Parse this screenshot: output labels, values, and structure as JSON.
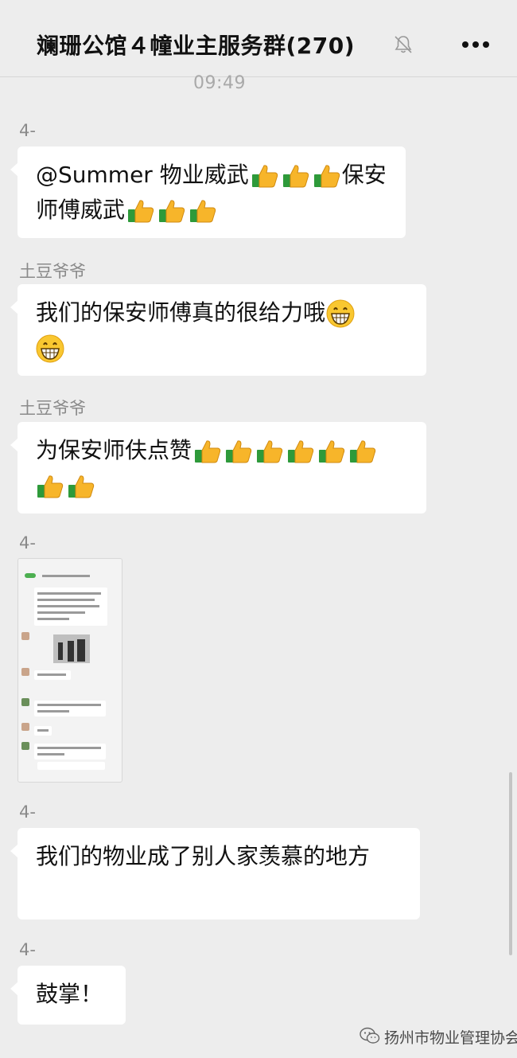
{
  "header": {
    "title": "斓珊公馆４幢业主服务群(270)",
    "mute_icon": "bell-mute-icon",
    "more_icon": "ellipsis-icon"
  },
  "timestamp": "09:49",
  "messages": [
    {
      "sender": "4-",
      "text_1": "@Summer 物业威武",
      "text_2": "保安师傅威武",
      "emoji": "thumbs-up"
    },
    {
      "sender": "土豆爷爷",
      "text": "我们的保安师傅真的很给力哦",
      "emoji": "grinning-face"
    },
    {
      "sender": "土豆爷爷",
      "text": "为保安师伕点赞",
      "emoji": "thumbs-up"
    },
    {
      "sender": "4-",
      "type": "image",
      "description": "chat-screenshot-thumbnail"
    },
    {
      "sender": "4-",
      "text": "我们的物业成了别人家羡慕的地方"
    },
    {
      "sender": "4-",
      "text": "鼓掌！"
    }
  ],
  "watermark": {
    "text": "扬州市物业管理协会",
    "icon": "wechat-icon"
  },
  "colors": {
    "background": "#ededed",
    "bubble": "#ffffff",
    "sender": "#8a8a8a",
    "timestamp": "#a9a9a9"
  }
}
